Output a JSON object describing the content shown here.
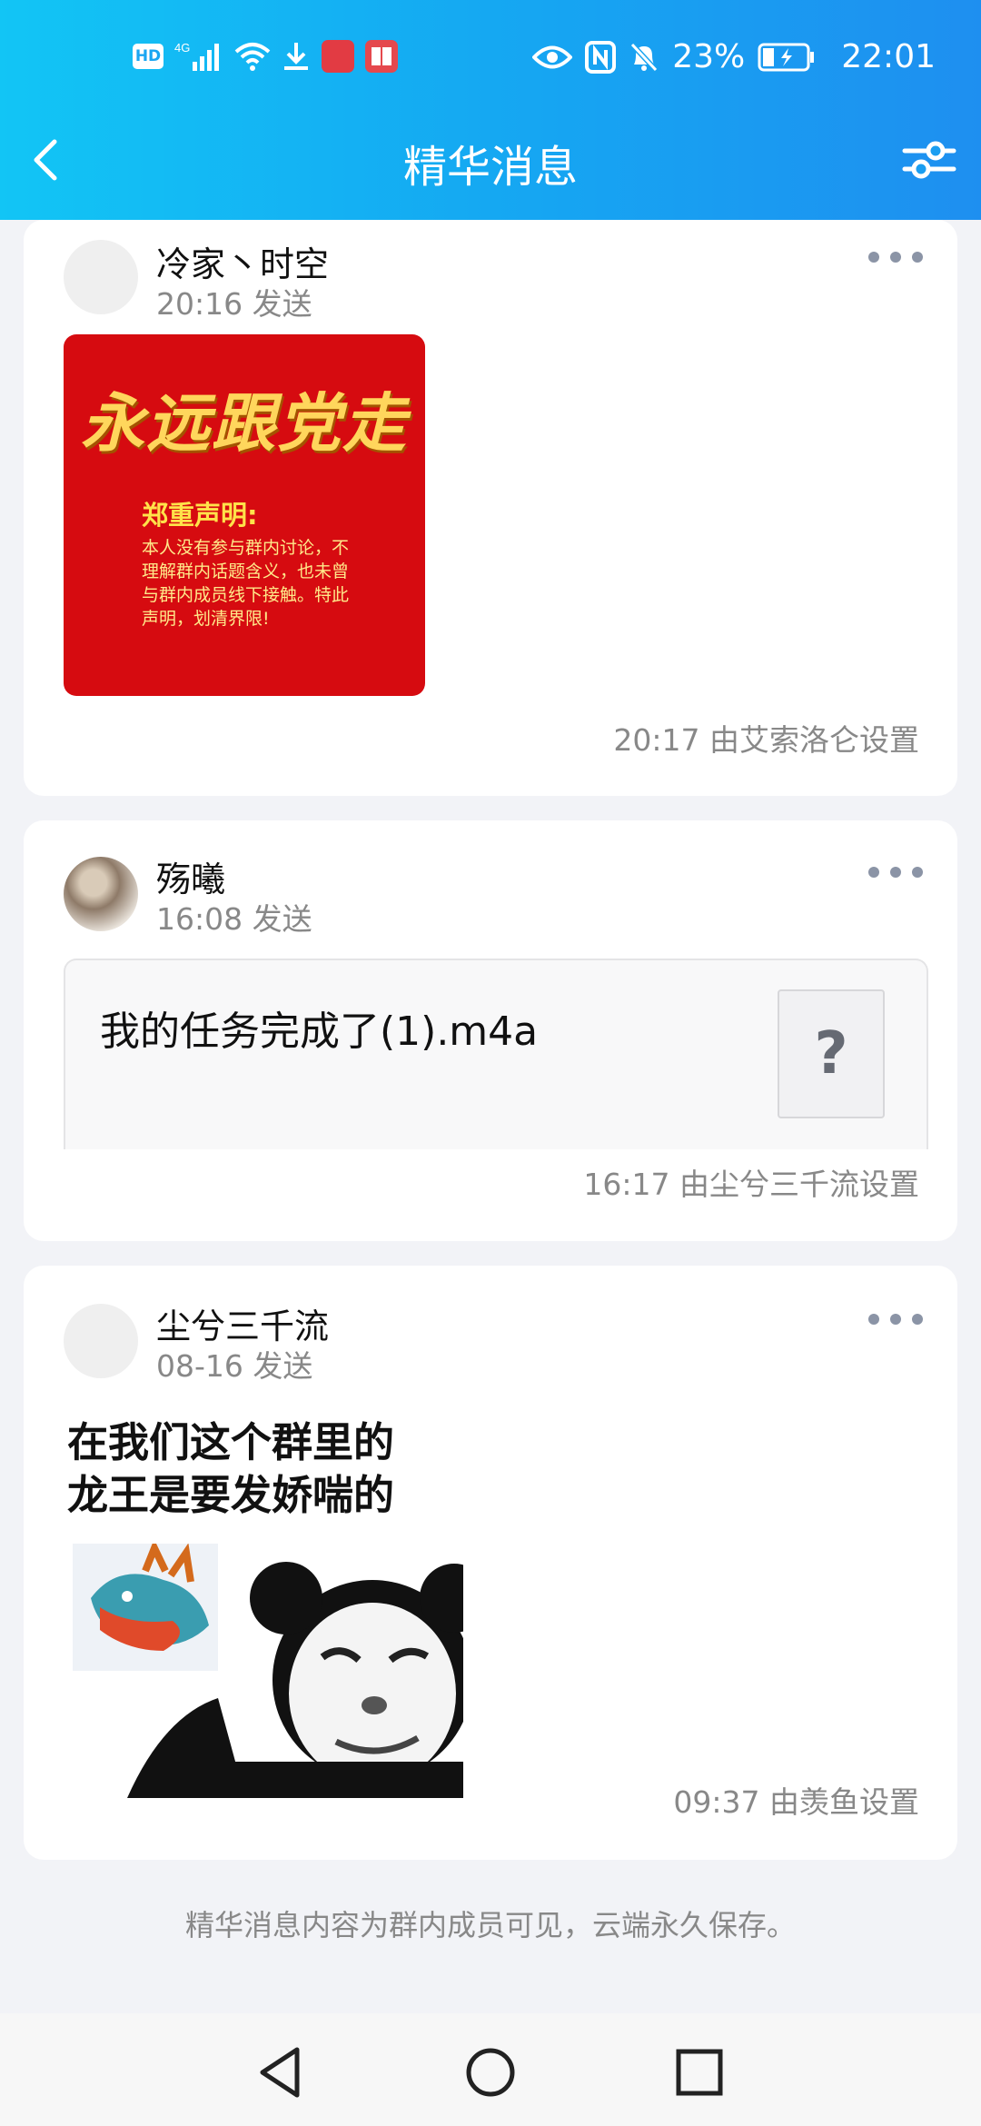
{
  "status_bar": {
    "hd": "HD",
    "network": "4G",
    "battery": "23%",
    "time": "22:01"
  },
  "nav": {
    "title": "精华消息",
    "back_icon": "back-arrow-icon",
    "filter_icon": "filter-sliders-icon"
  },
  "messages": [
    {
      "author": "冷家丶时空",
      "sent": "20:16 发送",
      "poster": {
        "slogan": "永远跟党走",
        "heading": "郑重声明:",
        "body": "本人没有参与群内讨论，不理解群内话题含义，也未曾与群内成员线下接触。特此声明，划清界限!"
      },
      "setter": "20:17 由艾索洛仑设置"
    },
    {
      "author": "殇曦",
      "sent": "16:08 发送",
      "file_name": "我的任务完成了(1).m4a",
      "file_thumb": "?",
      "setter": "16:17 由尘兮三千流设置"
    },
    {
      "author": "尘兮三千流",
      "sent": "08-16 发送",
      "sticker_text_line1": "在我们这个群里的",
      "sticker_text_line2": "龙王是要发娇喘的",
      "setter": "09:37 由羡鱼设置"
    }
  ],
  "footer_note": "精华消息内容为群内成员可见，云端永久保存。",
  "colors": {
    "header_start": "#12c5f5",
    "header_end": "#1e8ff0",
    "background": "#f2f3f7",
    "poster_red": "#d60b10"
  }
}
